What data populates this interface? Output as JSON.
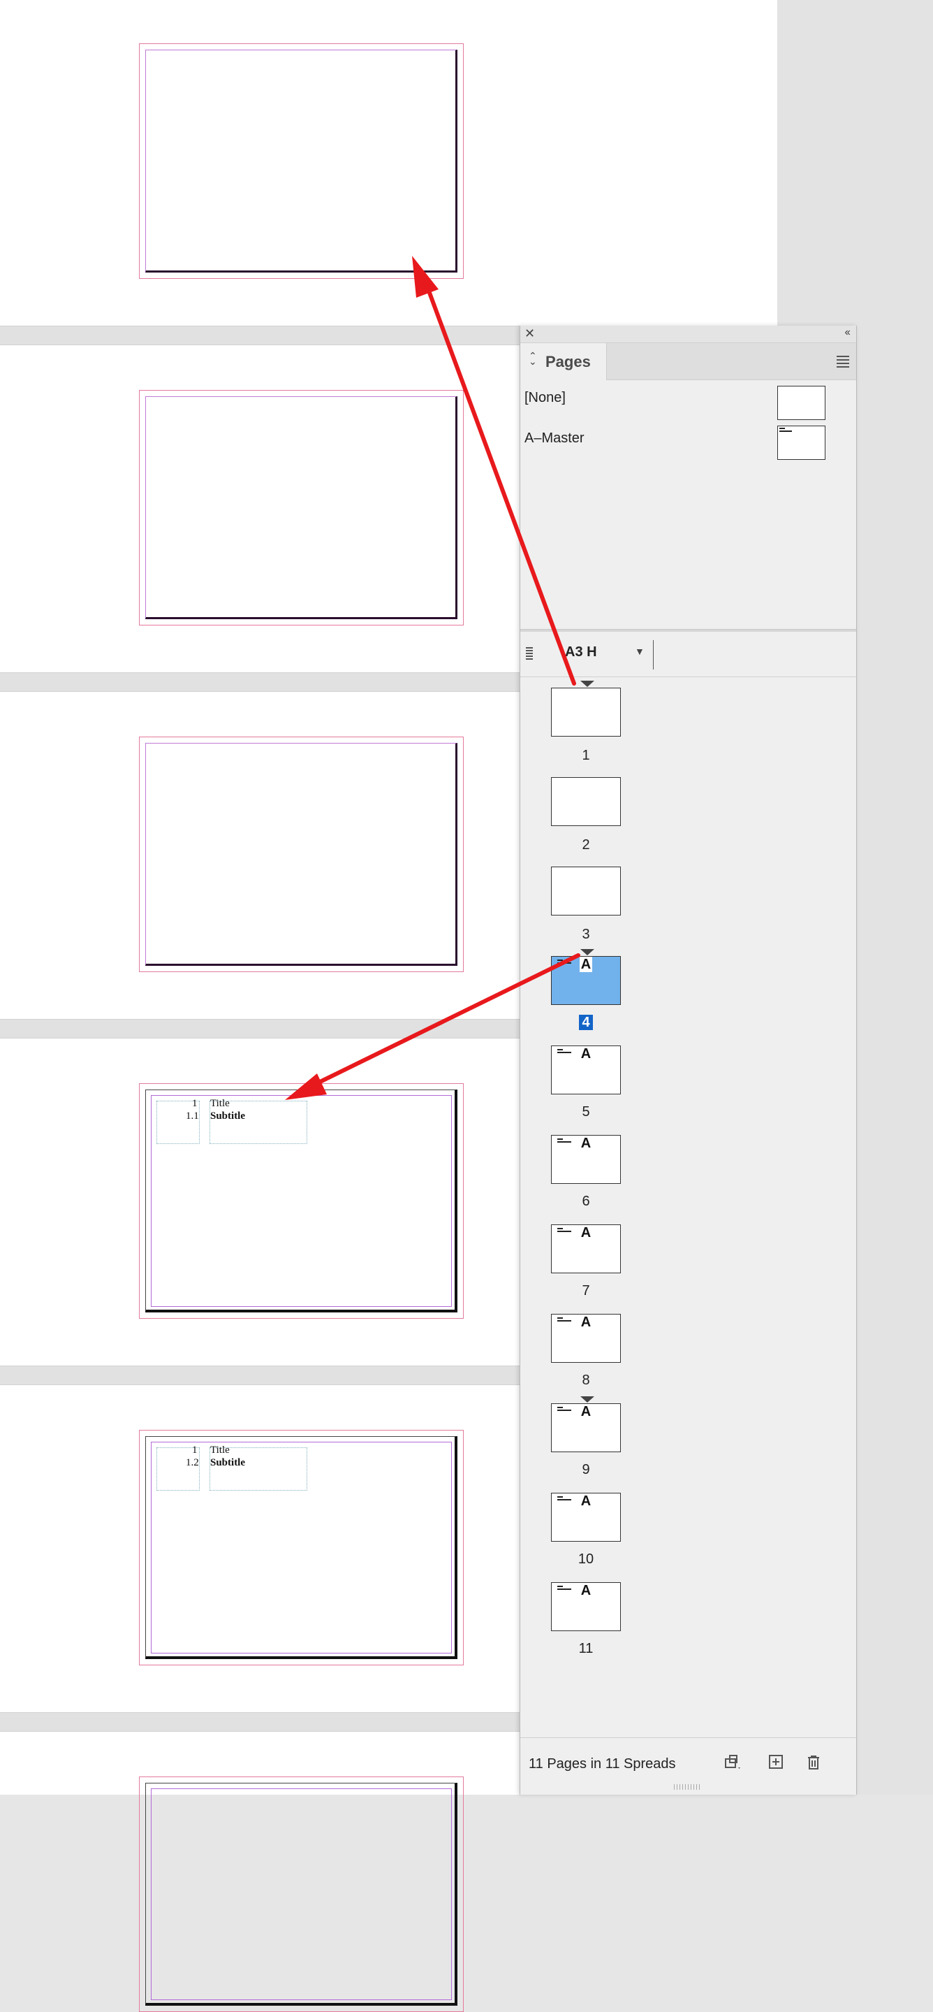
{
  "document": {
    "pages": [
      {
        "type": "blank"
      },
      {
        "type": "blank"
      },
      {
        "type": "blank"
      },
      {
        "type": "master",
        "number": "1",
        "subnumber": "1.1",
        "title": "Title",
        "subtitle": "Subtitle"
      },
      {
        "type": "master",
        "number": "1",
        "subnumber": "1.2",
        "title": "Title",
        "subtitle": "Subtitle"
      }
    ]
  },
  "panel": {
    "title": "Pages",
    "close_icon": "close-icon",
    "collapse_label": "‹‹",
    "masters": [
      {
        "label": "[None]"
      },
      {
        "label": "A–Master"
      }
    ],
    "page_size": "A3 H",
    "page_thumbs": [
      {
        "label": "1",
        "master": ""
      },
      {
        "label": "2",
        "master": ""
      },
      {
        "label": "3",
        "master": ""
      },
      {
        "label": "4",
        "master": "A",
        "selected": true
      },
      {
        "label": "5",
        "master": "A"
      },
      {
        "label": "6",
        "master": "A"
      },
      {
        "label": "7",
        "master": "A"
      },
      {
        "label": "8",
        "master": "A"
      },
      {
        "label": "9",
        "master": "A"
      },
      {
        "label": "10",
        "master": "A"
      },
      {
        "label": "11",
        "master": "A"
      }
    ],
    "footer_text": "11 Pages in 11 Spreads"
  },
  "colors": {
    "annotation_arrow": "#e8191c",
    "selection": "#72b2ec",
    "page_label_selected": "#1464c8"
  }
}
